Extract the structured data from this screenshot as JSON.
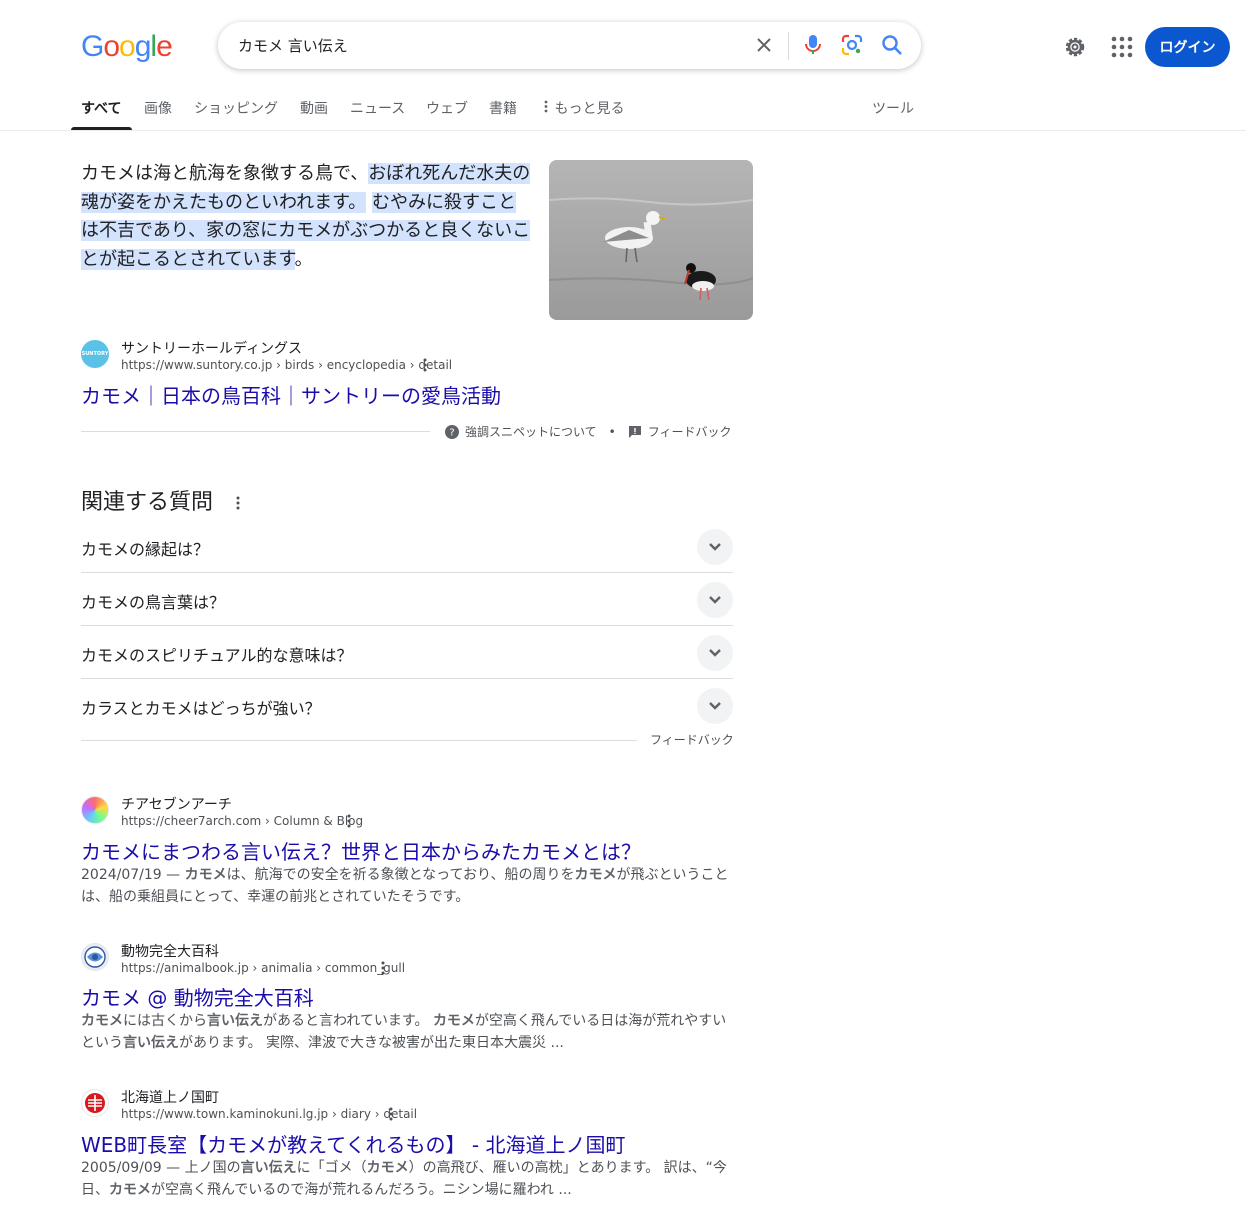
{
  "header": {
    "logo_text": "Google",
    "query": "カモメ 言い伝え",
    "login_label": "ログイン"
  },
  "tabs": [
    {
      "label": "すべて"
    },
    {
      "label": "画像"
    },
    {
      "label": "ショッピング"
    },
    {
      "label": "動画"
    },
    {
      "label": "ニュース"
    },
    {
      "label": "ウェブ"
    },
    {
      "label": "書籍"
    },
    {
      "label": "もっと見る"
    }
  ],
  "tools_label": "ツール",
  "snippet": {
    "text_plain": "カモメは海と航海を象徴する鳥で、",
    "text_highlight1": "おぼれ死んだ水夫の魂が姿をかえたものといわれます。",
    "text_highlight2": "むやみに殺すことは不吉であり、家の窓にカモメがぶつかると良くないことが起こるとされています",
    "text_end": "。",
    "site": "サントリーホールディングス",
    "favicon_text": "SUNTORY",
    "url": "https://www.suntory.co.jp › birds › encyclopedia › detail",
    "title": "カモメ｜日本の鳥百科｜サントリーの愛鳥活動",
    "about_label": "強調スニペットについて",
    "feedback_label": "フィードバック",
    "bullet": "•"
  },
  "paa": {
    "title": "関連する質問",
    "questions": [
      "カモメの縁起は？",
      "カモメの鳥言葉は？",
      "カモメのスピリチュアル的な意味は？",
      "カラスとカモメはどっちが強い？"
    ],
    "feedback_label": "フィードバック"
  },
  "results": [
    {
      "site": "チアセブンアーチ",
      "url": "https://cheer7arch.com › Column & Blog",
      "title": "カモメにまつわる言い伝え？世界と日本からみたカモメとは？",
      "desc_line1_pre": "2024/07/19 — ",
      "desc_b1": "カモメ",
      "desc_line1_mid": "は、航海での安全を祈る象徴となっており、船の周りを",
      "desc_b2": "カモメ",
      "desc_line1_post": "が飛ぶということ",
      "desc_line2": "は、船の乗組員にとって、幸運の前兆とされていたそうです。"
    },
    {
      "site": "動物完全大百科",
      "url": "https://animalbook.jp › animalia › common_gull",
      "title": "カモメ @ 動物完全大百科",
      "d_b1": "カモメ",
      "d_t1": "には古くから",
      "d_b2": "言い伝え",
      "d_t2": "があると言われています。 ",
      "d_b3": "カモメ",
      "d_t3": "が空高く飛んでいる日は海が荒れやすい",
      "d_t4": "という",
      "d_b4": "言い伝え",
      "d_t5": "があります。 実際、津波で大きな被害が出た東日本大震災 ..."
    },
    {
      "site": "北海道上ノ国町",
      "url": "https://www.town.kaminokuni.lg.jp › diary › detail",
      "title": "WEB町長室【カモメが教えてくれるもの】 - 北海道上ノ国町",
      "d_t1": "2005/09/09 — 上ノ国の",
      "d_b1": "言い伝え",
      "d_t2": "に「ゴメ（",
      "d_b2": "カモメ",
      "d_t3": "）の高飛び、雁いの高枕」とあります。 訳は、“今",
      "d_t4": "日、",
      "d_b3": "カモメ",
      "d_t5": "が空高く飛んでいるので海が荒れるんだろう。ニシン場に羅われ ..."
    }
  ],
  "colors": {
    "link": "#1a0dab",
    "highlight": "#d3e3fd",
    "login_bg": "#0b57d0"
  }
}
